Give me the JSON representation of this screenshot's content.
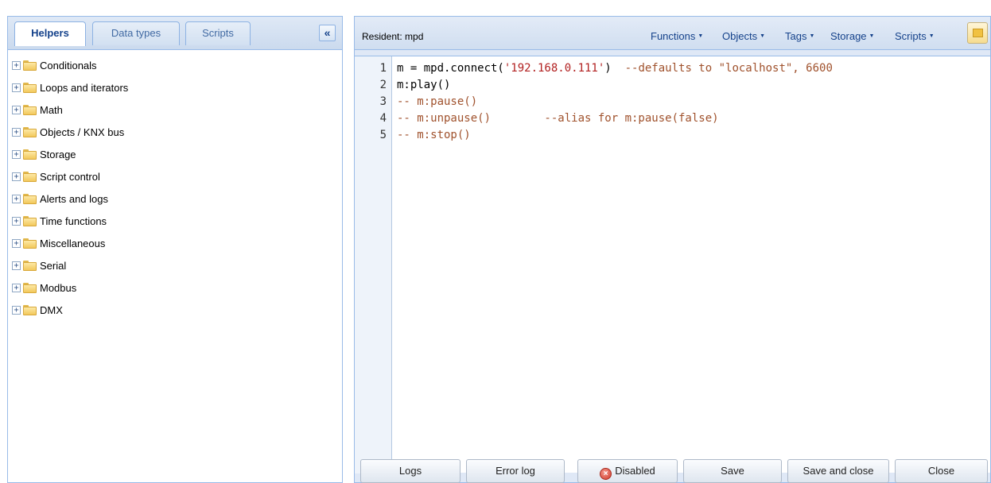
{
  "left": {
    "tabs": [
      {
        "label": "Helpers"
      },
      {
        "label": "Data types"
      },
      {
        "label": "Scripts"
      }
    ],
    "collapse_glyph": "«",
    "tree": [
      {
        "label": "Conditionals"
      },
      {
        "label": "Loops and iterators"
      },
      {
        "label": "Math"
      },
      {
        "label": "Objects / KNX bus"
      },
      {
        "label": "Storage"
      },
      {
        "label": "Script control"
      },
      {
        "label": "Alerts and logs"
      },
      {
        "label": "Time functions"
      },
      {
        "label": "Miscellaneous"
      },
      {
        "label": "Serial"
      },
      {
        "label": "Modbus"
      },
      {
        "label": "DMX"
      }
    ]
  },
  "right": {
    "title": "Resident: mpd",
    "menus": [
      {
        "label": "Functions"
      },
      {
        "label": "Objects"
      },
      {
        "label": "Tags"
      },
      {
        "label": "Storage"
      },
      {
        "label": "Scripts"
      }
    ],
    "code": {
      "line_numbers": [
        "1",
        "2",
        "3",
        "4",
        "5"
      ],
      "line1_code": "m = mpd.connect(",
      "line1_string": "'192.168.0.111'",
      "line1_mid": ")  ",
      "line1_comment": "--defaults to \"localhost\", 6600",
      "line2": "m:play()",
      "line3": "-- m:pause()",
      "line4": "-- m:unpause()        --alias for m:pause(false)",
      "line5": "-- m:stop()"
    },
    "buttons": {
      "logs": "Logs",
      "error_log": "Error log",
      "disabled": "Disabled",
      "save": "Save",
      "save_and_close": "Save and close",
      "close": "Close"
    }
  }
}
